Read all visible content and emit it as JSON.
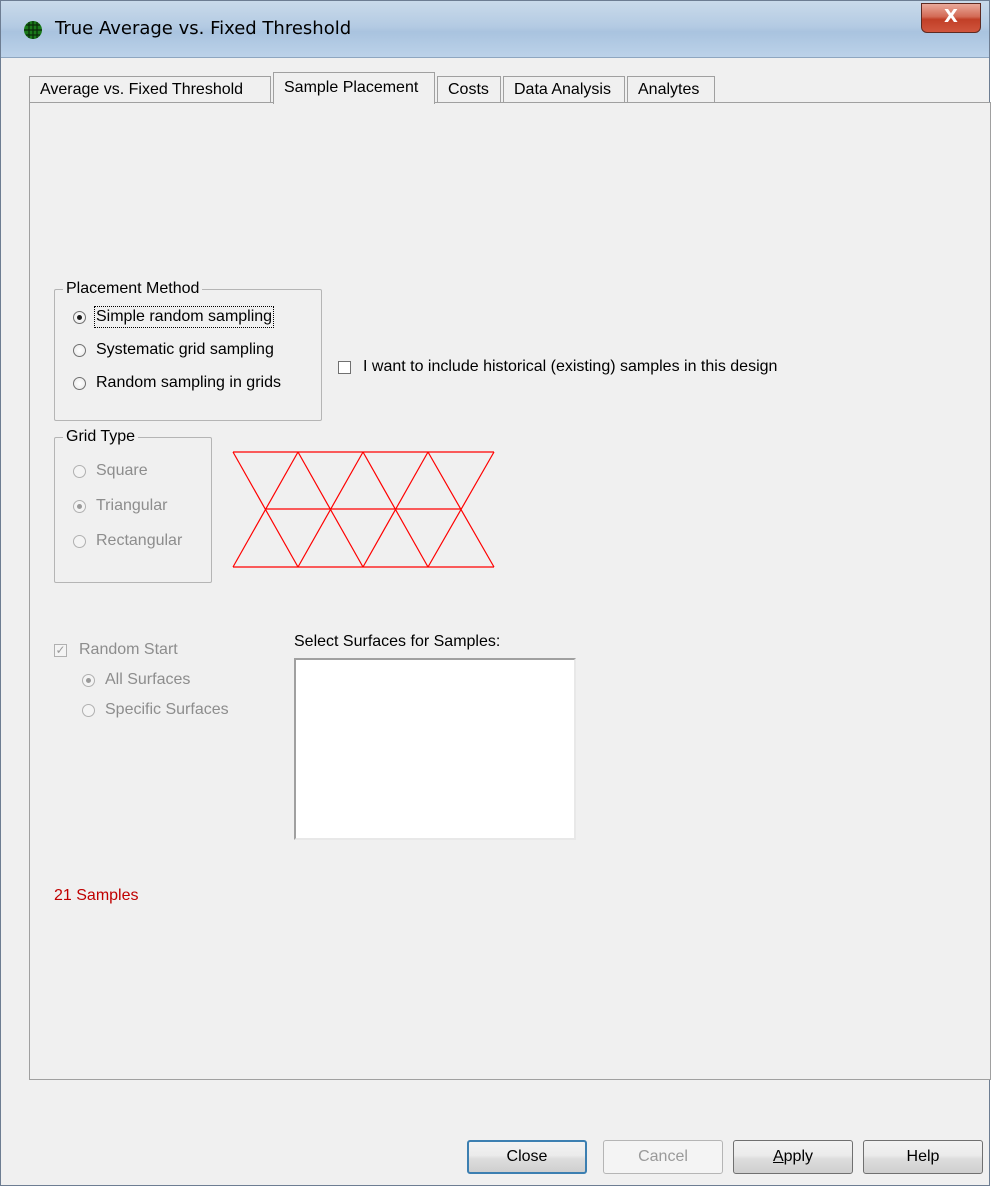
{
  "window": {
    "title": "True Average vs. Fixed Threshold",
    "close_glyph": "X"
  },
  "tabs": [
    {
      "label": "Average vs. Fixed Threshold",
      "active": false
    },
    {
      "label": "Sample Placement",
      "active": true
    },
    {
      "label": "Costs",
      "active": false
    },
    {
      "label": "Data Analysis",
      "active": false
    },
    {
      "label": "Analytes",
      "active": false
    }
  ],
  "placement_method": {
    "label": "Placement Method",
    "options": [
      {
        "label": "Simple random sampling",
        "checked": true
      },
      {
        "label": "Systematic grid sampling",
        "checked": false
      },
      {
        "label": "Random sampling in grids",
        "checked": false
      }
    ]
  },
  "historical_checkbox": {
    "label": "I want to include historical (existing) samples in this design",
    "checked": false
  },
  "grid_type": {
    "label": "Grid Type",
    "options": [
      {
        "label": "Square",
        "checked": false
      },
      {
        "label": "Triangular",
        "checked": true
      },
      {
        "label": "Rectangular",
        "checked": false
      }
    ],
    "preview_color": "#ff0000"
  },
  "random_start": {
    "label": "Random Start",
    "checked": true,
    "options": [
      {
        "label": "All Surfaces",
        "checked": true
      },
      {
        "label": "Specific Surfaces",
        "checked": false
      }
    ]
  },
  "surfaces": {
    "label": "Select Surfaces for Samples:"
  },
  "status": {
    "samples_text": "21 Samples",
    "color": "#c00000"
  },
  "buttons": {
    "close": "Close",
    "cancel": "Cancel",
    "apply_prefix": "A",
    "apply_rest": "pply",
    "help": "Help"
  }
}
